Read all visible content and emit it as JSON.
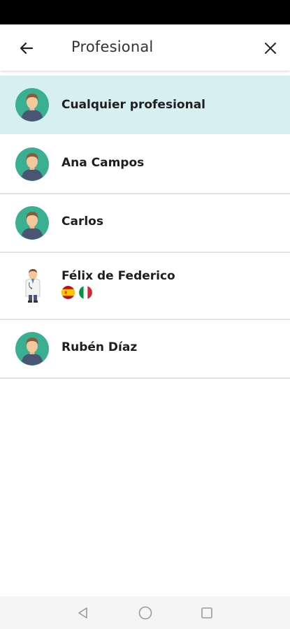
{
  "header": {
    "title": "Profesional",
    "back_icon": "arrow-left-icon",
    "close_icon": "close-icon"
  },
  "professionals": [
    {
      "name": "Cualquier profesional",
      "avatar": "avatar-icon",
      "selected": true
    },
    {
      "name": "Ana Campos",
      "avatar": "avatar-icon",
      "selected": false
    },
    {
      "name": "Carlos",
      "avatar": "avatar-icon",
      "selected": false
    },
    {
      "name": "Félix de Federico",
      "avatar": "doctor-icon",
      "selected": false,
      "languages": [
        "es",
        "it"
      ]
    },
    {
      "name": "Rubén Díaz",
      "avatar": "avatar-icon",
      "selected": false
    }
  ],
  "colors": {
    "selected_row": "#d7efef",
    "avatar_bg": "#3aaf91",
    "divider": "#e2e2e2"
  },
  "nav": {
    "back": "triangle-back-icon",
    "home": "circle-home-icon",
    "recents": "square-recents-icon"
  }
}
